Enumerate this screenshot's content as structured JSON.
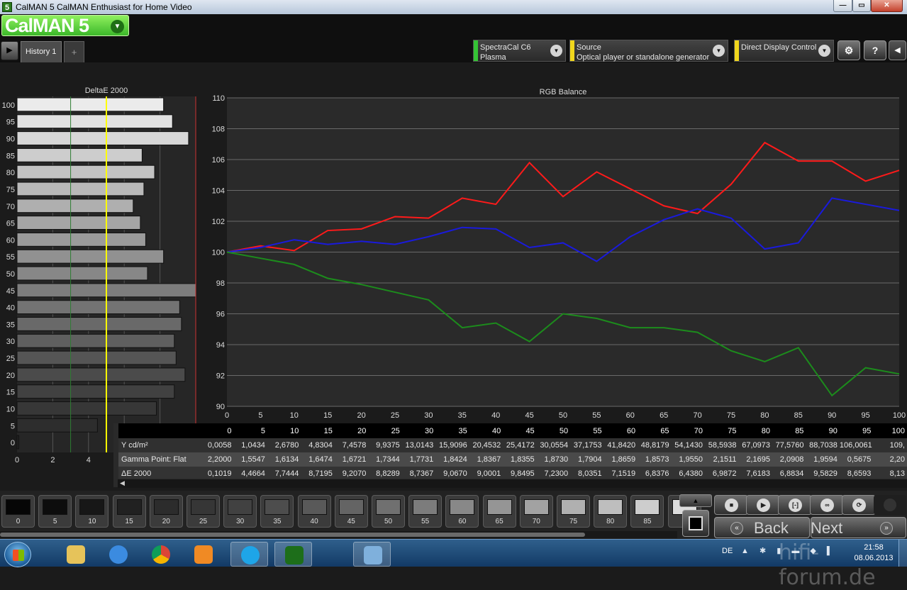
{
  "window": {
    "app_icon": "5",
    "title": "CalMAN 5 CalMAN Enthusiast for Home Video",
    "min_glyph": "—",
    "max_glyph": "▭",
    "close_glyph": "✕"
  },
  "header": {
    "logo_text": "CalMAN 5",
    "logo_menu_glyph": "▼",
    "nav_glyph": "▶",
    "tab_label": "History 1",
    "add_tab_glyph": "+",
    "meter": {
      "line1": "SpectraCal C6",
      "line2": "Plasma",
      "color": "#35c435"
    },
    "source": {
      "line1": "Source",
      "line2": "Optical player or standalone generator",
      "color": "#f0d61c"
    },
    "display": {
      "line1": "Direct Display Control",
      "line2": "",
      "color": "#f0d61c"
    },
    "dropdown_glyph": "▼",
    "settings_glyph": "⚙",
    "help_glyph": "?",
    "collapse_glyph": "◀"
  },
  "chart_data": [
    {
      "type": "bar",
      "title": "DeltaE 2000",
      "orientation": "horizontal",
      "categories": [
        "100",
        "95",
        "90",
        "85",
        "80",
        "75",
        "70",
        "65",
        "60",
        "55",
        "50",
        "45",
        "40",
        "35",
        "30",
        "25",
        "20",
        "15",
        "10",
        "5",
        "0"
      ],
      "values": [
        8.2,
        8.7,
        9.6,
        7.0,
        7.7,
        7.1,
        6.5,
        6.9,
        7.2,
        8.2,
        7.3,
        10.0,
        9.1,
        9.2,
        8.8,
        8.9,
        9.4,
        8.8,
        7.8,
        4.5,
        0.1
      ],
      "xticks": [
        0,
        2,
        4
      ],
      "xlim": [
        0,
        10
      ],
      "reference_lines": [
        3,
        5
      ],
      "reference_colors": [
        "#2e7d32",
        "#ffff00"
      ]
    },
    {
      "type": "line",
      "title": "RGB Balance",
      "x": [
        0,
        5,
        10,
        15,
        20,
        25,
        30,
        35,
        40,
        45,
        50,
        55,
        60,
        65,
        70,
        75,
        80,
        85,
        90,
        95,
        100
      ],
      "xlim": [
        0,
        100
      ],
      "ylim": [
        90,
        110
      ],
      "yticks": [
        90,
        92,
        94,
        96,
        98,
        100,
        102,
        104,
        106,
        108,
        110
      ],
      "grid": true,
      "series": [
        {
          "color": "#ff1a1a",
          "values": [
            100.0,
            100.4,
            100.1,
            101.4,
            101.5,
            102.3,
            102.2,
            103.5,
            103.1,
            105.8,
            103.6,
            105.2,
            104.1,
            103.0,
            102.5,
            104.4,
            107.1,
            105.9,
            105.9,
            104.6,
            105.3
          ]
        },
        {
          "color": "#1a1adc",
          "values": [
            100.0,
            100.3,
            100.8,
            100.5,
            100.7,
            100.5,
            101.0,
            101.6,
            101.5,
            100.3,
            100.6,
            99.4,
            101.0,
            102.1,
            102.8,
            102.2,
            100.2,
            100.6,
            103.5,
            103.1,
            102.7
          ]
        },
        {
          "color": "#1c8c1c",
          "values": [
            100.0,
            99.6,
            99.2,
            98.3,
            97.9,
            97.4,
            96.9,
            95.1,
            95.4,
            94.2,
            96.0,
            95.7,
            95.1,
            95.1,
            94.8,
            93.6,
            92.9,
            93.8,
            90.7,
            92.5,
            92.1
          ]
        }
      ]
    }
  ],
  "table": {
    "columns": [
      "0",
      "5",
      "10",
      "15",
      "20",
      "25",
      "30",
      "35",
      "40",
      "45",
      "50",
      "55",
      "60",
      "65",
      "70",
      "75",
      "80",
      "85",
      "90",
      "95",
      "100"
    ],
    "rows": [
      {
        "label": "Y cd/m²",
        "cells": [
          "0,0058",
          "1,0434",
          "2,6780",
          "4,8304",
          "7,4578",
          "9,9375",
          "13,0143",
          "15,9096",
          "20,4532",
          "25,4172",
          "30,0554",
          "37,1753",
          "41,8420",
          "48,8179",
          "54,1430",
          "58,5938",
          "67,0973",
          "77,5760",
          "88,7038",
          "106,0061",
          "109,"
        ]
      },
      {
        "label": "Gamma Point: Flat",
        "cells": [
          "2,2000",
          "1,5547",
          "1,6134",
          "1,6474",
          "1,6721",
          "1,7344",
          "1,7731",
          "1,8424",
          "1,8367",
          "1,8355",
          "1,8730",
          "1,7904",
          "1,8659",
          "1,8573",
          "1,9550",
          "2,1511",
          "2,1695",
          "2,0908",
          "1,9594",
          "0,5675",
          "2,20"
        ]
      },
      {
        "label": "ΔE 2000",
        "cells": [
          "0,1019",
          "4,4664",
          "7,7444",
          "8,7195",
          "9,2070",
          "8,8289",
          "8,7367",
          "9,0670",
          "9,0001",
          "9,8495",
          "7,2300",
          "8,0351",
          "7,1519",
          "6,8376",
          "6,4380",
          "6,9872",
          "7,6183",
          "6,8834",
          "9,5829",
          "8,6593",
          "8,13"
        ]
      }
    ],
    "scroll_glyph": "◀"
  },
  "swatches": [
    {
      "label": "0",
      "color": "#060606"
    },
    {
      "label": "5",
      "color": "#0d0d0d"
    },
    {
      "label": "10",
      "color": "#171717"
    },
    {
      "label": "15",
      "color": "#212121"
    },
    {
      "label": "20",
      "color": "#2c2c2c"
    },
    {
      "label": "25",
      "color": "#363636"
    },
    {
      "label": "30",
      "color": "#414141"
    },
    {
      "label": "35",
      "color": "#4d4d4d"
    },
    {
      "label": "40",
      "color": "#595959"
    },
    {
      "label": "45",
      "color": "#646464"
    },
    {
      "label": "50",
      "color": "#707070"
    },
    {
      "label": "55",
      "color": "#7c7c7c"
    },
    {
      "label": "60",
      "color": "#888888"
    },
    {
      "label": "65",
      "color": "#959595"
    },
    {
      "label": "70",
      "color": "#a2a2a2"
    },
    {
      "label": "75",
      "color": "#b0b0b0"
    },
    {
      "label": "80",
      "color": "#bebebe"
    },
    {
      "label": "85",
      "color": "#cdcdcd"
    },
    {
      "label": "",
      "color": "#dcdcdc"
    }
  ],
  "controls": {
    "up_glyph": "▲",
    "stop_glyph": "■",
    "play_glyph": "▶",
    "frame_glyph": "[‑]",
    "loop_glyph": "∞",
    "refresh_glyph": "⟳",
    "back_label": "Back",
    "back_glyph": "«",
    "next_label": "Next",
    "next_glyph": "»"
  },
  "taskbar": {
    "language": "DE",
    "tray_glyphs": "▲ ✱ ▮ ▬ ◆ ▌",
    "time": "21:58",
    "date": "08.06.2013",
    "watermark": "hifi-forum.de"
  }
}
